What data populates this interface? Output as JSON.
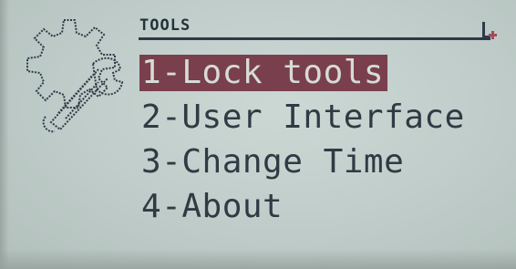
{
  "header": {
    "title": "TOOLS",
    "corner_icon": "flag-icon",
    "side_icon": "gear-wrench-icon"
  },
  "menu": {
    "selected_index": 0,
    "items": [
      {
        "label": "1-Lock tools"
      },
      {
        "label": "2-User Interface"
      },
      {
        "label": "3-Change Time"
      },
      {
        "label": "4-About"
      }
    ]
  },
  "colors": {
    "lcd_background": "#c1cecb",
    "pixel_dark": "#2f3b44",
    "highlight": "#7a3f4c"
  }
}
